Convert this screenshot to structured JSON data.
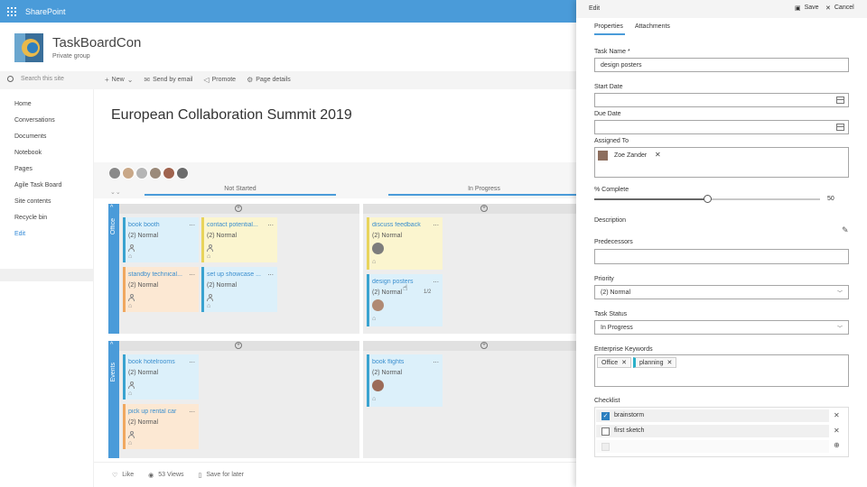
{
  "topbar": {
    "brand": "SharePoint"
  },
  "site": {
    "title": "TaskBoardCon",
    "subtitle": "Private group"
  },
  "search": {
    "placeholder": "Search this site"
  },
  "commands": {
    "new": "New",
    "send_by_email": "Send by email",
    "promote": "Promote",
    "page_details": "Page details"
  },
  "nav": [
    {
      "label": "Home"
    },
    {
      "label": "Conversations"
    },
    {
      "label": "Documents"
    },
    {
      "label": "Notebook"
    },
    {
      "label": "Pages"
    },
    {
      "label": "Agile Task Board"
    },
    {
      "label": "Site contents"
    },
    {
      "label": "Recycle bin"
    },
    {
      "label": "Edit"
    }
  ],
  "page": {
    "title": "European Collaboration Summit 2019"
  },
  "board": {
    "columns": [
      {
        "label": "Not Started"
      },
      {
        "label": "In Progress"
      }
    ],
    "lanes": [
      {
        "label": "Office"
      },
      {
        "label": "Events"
      }
    ],
    "cards": [
      {
        "title": "book booth",
        "priority": "(2) Normal"
      },
      {
        "title": "contact potential...",
        "priority": "(2) Normal"
      },
      {
        "title": "standby technical...",
        "priority": "(2) Normal"
      },
      {
        "title": "set up showcase ...",
        "priority": "(2) Normal"
      },
      {
        "title": "discuss feedback",
        "priority": "(2) Normal"
      },
      {
        "title": "design posters",
        "priority": "(2) Normal",
        "extra": "1/2"
      },
      {
        "title": "book hotelrooms",
        "priority": "(2) Normal"
      },
      {
        "title": "pick up rental car",
        "priority": "(2) Normal"
      },
      {
        "title": "book flights",
        "priority": "(2) Normal"
      }
    ],
    "menu_dots": "...",
    "add_symbol": "+",
    "collapse_symbol": "^"
  },
  "footer": {
    "like": "Like",
    "views": "53 Views",
    "save_for_later": "Save for later"
  },
  "panel": {
    "title": "Edit",
    "save": "Save",
    "cancel": "Cancel",
    "tabs": {
      "properties": "Properties",
      "attachments": "Attachments"
    },
    "fields": {
      "task_name_label": "Task Name *",
      "task_name_value": "design posters",
      "start_date_label": "Start Date",
      "due_date_label": "Due Date",
      "assigned_to_label": "Assigned To",
      "assigned_to_value": "Zoe Zander",
      "percent_complete_label": "% Complete",
      "percent_complete_value": "50",
      "percent_complete": 50,
      "description_label": "Description",
      "predecessors_label": "Predecessors",
      "priority_label": "Priority",
      "priority_value": "(2) Normal",
      "task_status_label": "Task Status",
      "task_status_value": "In Progress",
      "keywords_label": "Enterprise Keywords",
      "keywords": [
        "Office",
        "planning"
      ],
      "checklist_label": "Checklist",
      "checklist": [
        {
          "label": "brainstorm",
          "checked": true
        },
        {
          "label": "first sketch",
          "checked": false
        }
      ]
    }
  },
  "colors": {
    "accent": "#4a9bd9",
    "card_blue": "#dcf0fa",
    "card_yellow": "#fbf5cf",
    "card_orange": "#fce8d3"
  }
}
